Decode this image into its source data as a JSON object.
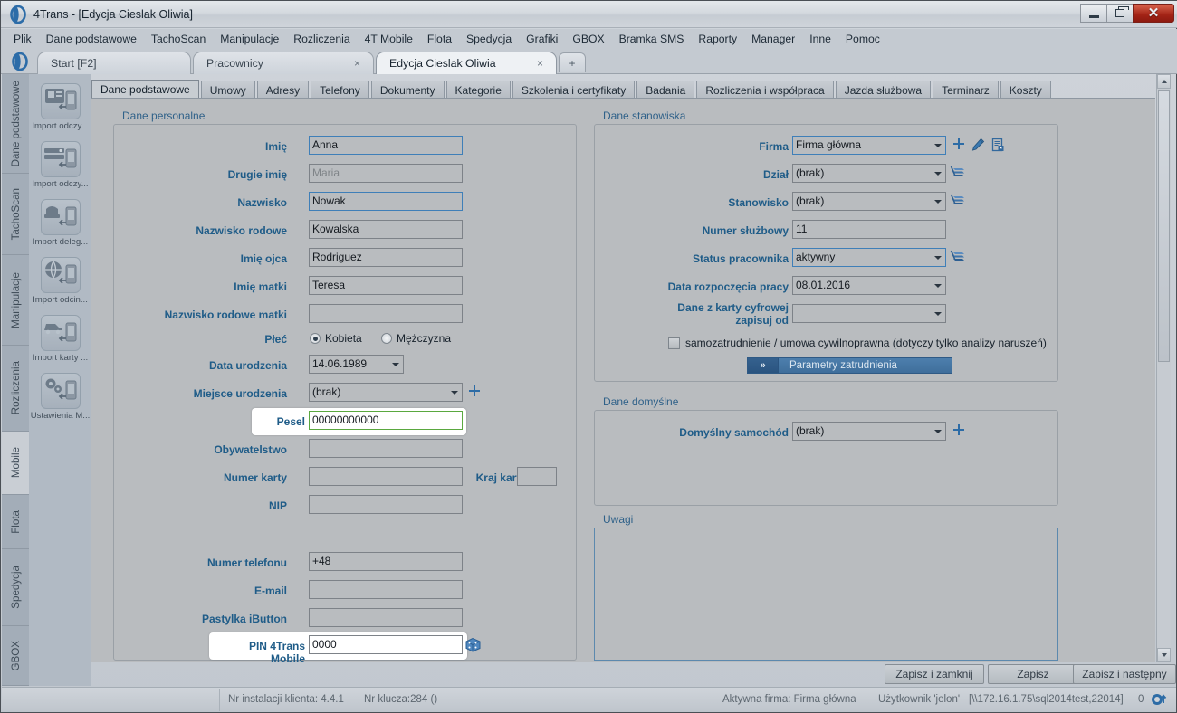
{
  "window": {
    "title": "4Trans - [Edycja Cieslak Oliwia]",
    "minimize": "minimize-icon",
    "maximize": "restore-icon",
    "close": "close-icon"
  },
  "menubar": [
    "Plik",
    "Dane podstawowe",
    "TachoScan",
    "Manipulacje",
    "Rozliczenia",
    "4T Mobile",
    "Flota",
    "Spedycja",
    "Grafiki",
    "GBOX",
    "Bramka SMS",
    "Raporty",
    "Manager",
    "Inne",
    "Pomoc"
  ],
  "doc_tabs": [
    {
      "label": "Start [F2]",
      "closable": false,
      "active": false
    },
    {
      "label": "Pracownicy",
      "closable": true,
      "active": false
    },
    {
      "label": "Edycja Cieslak Oliwia",
      "closable": true,
      "active": true
    }
  ],
  "tab_add_label": "+",
  "left_vertical_tabs": [
    {
      "label": "Dane podstawowe",
      "selected": false
    },
    {
      "label": "TachoScan",
      "selected": false
    },
    {
      "label": "Manipulacje",
      "selected": false
    },
    {
      "label": "Rozliczenia",
      "selected": false
    },
    {
      "label": "Mobile",
      "selected": true
    },
    {
      "label": "Flota",
      "selected": false
    },
    {
      "label": "Spedycja",
      "selected": false
    },
    {
      "label": "GBOX",
      "selected": false
    }
  ],
  "icon_buttons": [
    {
      "label": "Import odczy...",
      "icon": "import-card-readout-icon"
    },
    {
      "label": "Import odczy...",
      "icon": "import-tacho-readout-icon"
    },
    {
      "label": "Import deleg...",
      "icon": "import-delegation-icon"
    },
    {
      "label": "Import odcin...",
      "icon": "import-route-section-icon"
    },
    {
      "label": "Import karty ...",
      "icon": "import-vehicle-card-icon"
    },
    {
      "label": "Ustawienia M...",
      "icon": "mobile-settings-icon"
    }
  ],
  "inner_tabs": [
    {
      "label": "Dane podstawowe",
      "active": true
    },
    {
      "label": "Umowy",
      "active": false
    },
    {
      "label": "Adresy",
      "active": false
    },
    {
      "label": "Telefony",
      "active": false
    },
    {
      "label": "Dokumenty",
      "active": false
    },
    {
      "label": "Kategorie",
      "active": false
    },
    {
      "label": "Szkolenia i certyfikaty",
      "active": false
    },
    {
      "label": "Badania",
      "active": false
    },
    {
      "label": "Rozliczenia i współpraca",
      "active": false
    },
    {
      "label": "Jazda służbowa",
      "active": false
    },
    {
      "label": "Terminarz",
      "active": false
    },
    {
      "label": "Koszty",
      "active": false
    }
  ],
  "groups": {
    "personal": "Dane personalne",
    "position": "Dane stanowiska",
    "defaults": "Dane domyślne",
    "notes": "Uwagi"
  },
  "personal_fields": {
    "imie": {
      "label": "Imię",
      "value": "Anna"
    },
    "drugie_imie": {
      "label": "Drugie imię",
      "value": "Maria"
    },
    "nazwisko": {
      "label": "Nazwisko",
      "value": "Nowak"
    },
    "nazwisko_rodowe": {
      "label": "Nazwisko rodowe",
      "value": "Kowalska"
    },
    "imie_ojca": {
      "label": "Imię ojca",
      "value": "Rodriguez"
    },
    "imie_matki": {
      "label": "Imię matki",
      "value": "Teresa"
    },
    "nazwisko_rodowe_matki": {
      "label": "Nazwisko rodowe matki",
      "value": ""
    },
    "plec": {
      "label": "Płeć",
      "option_female": "Kobieta",
      "option_male": "Mężczyzna",
      "selected": "Kobieta"
    },
    "data_urodzenia": {
      "label": "Data urodzenia",
      "value": "14.06.1989"
    },
    "miejsce_urodzenia": {
      "label": "Miejsce urodzenia",
      "value": "(brak)"
    },
    "pesel": {
      "label": "Pesel",
      "value": "00000000000"
    },
    "obywatelstwo": {
      "label": "Obywatelstwo",
      "value": ""
    },
    "numer_karty": {
      "label": "Numer karty",
      "value": ""
    },
    "kraj_karty": {
      "label": "Kraj karty",
      "value": ""
    },
    "nip": {
      "label": "NIP",
      "value": ""
    },
    "numer_telefonu": {
      "label": "Numer telefonu",
      "value": "+48"
    },
    "email": {
      "label": "E-mail",
      "value": ""
    },
    "pastylka": {
      "label": "Pastylka iButton",
      "value": ""
    },
    "pin": {
      "label": "PIN 4Trans Mobile",
      "value": "0000"
    }
  },
  "position_fields": {
    "firma": {
      "label": "Firma",
      "value": "Firma główna"
    },
    "dzial": {
      "label": "Dział",
      "value": "(brak)"
    },
    "stanowisko": {
      "label": "Stanowisko",
      "value": "(brak)"
    },
    "numer_sluzbowy": {
      "label": "Numer służbowy",
      "value": "11"
    },
    "status_pracownika": {
      "label": "Status pracownika",
      "value": "aktywny"
    },
    "data_rozpoczecia": {
      "label": "Data rozpoczęcia pracy",
      "value": "08.01.2016"
    },
    "dane_z_karty": {
      "label": "Dane z karty cyfrowej zapisuj od",
      "value": ""
    },
    "samozatrudnienie": {
      "label": "samozatrudnienie / umowa cywilnoprawna (dotyczy tylko analizy naruszeń)",
      "checked": false
    },
    "parametry_btn": {
      "chevron": "»",
      "label": "Parametry zatrudnienia"
    }
  },
  "defaults_fields": {
    "domyslny_samochod": {
      "label": "Domyślny samochód",
      "value": "(brak)"
    }
  },
  "notes_value": "",
  "row_icons": {
    "add": "plus-icon",
    "edit": "pencil-icon",
    "document": "document-export-icon",
    "list": "list-stack-icon",
    "dice": "dice-icon"
  },
  "buttons": {
    "save_close": "Zapisz i zamknij",
    "save": "Zapisz",
    "save_next": "Zapisz i następny"
  },
  "statusbar": {
    "install": "Nr instalacji klienta: 4.4.1",
    "key": "Nr klucza:284 ()",
    "active_company": "Aktywna firma: Firma główna",
    "user": "Użytkownik 'jelon'",
    "server": "[\\\\172.16.1.75\\sql2014test,22014]",
    "count": "0"
  },
  "colors": {
    "label_blue": "#1f5c88",
    "group_blue": "#2f6189",
    "focus_border": "#3f7fb8",
    "valid_green": "#5aa83f",
    "accent": "#2d6ca6"
  }
}
